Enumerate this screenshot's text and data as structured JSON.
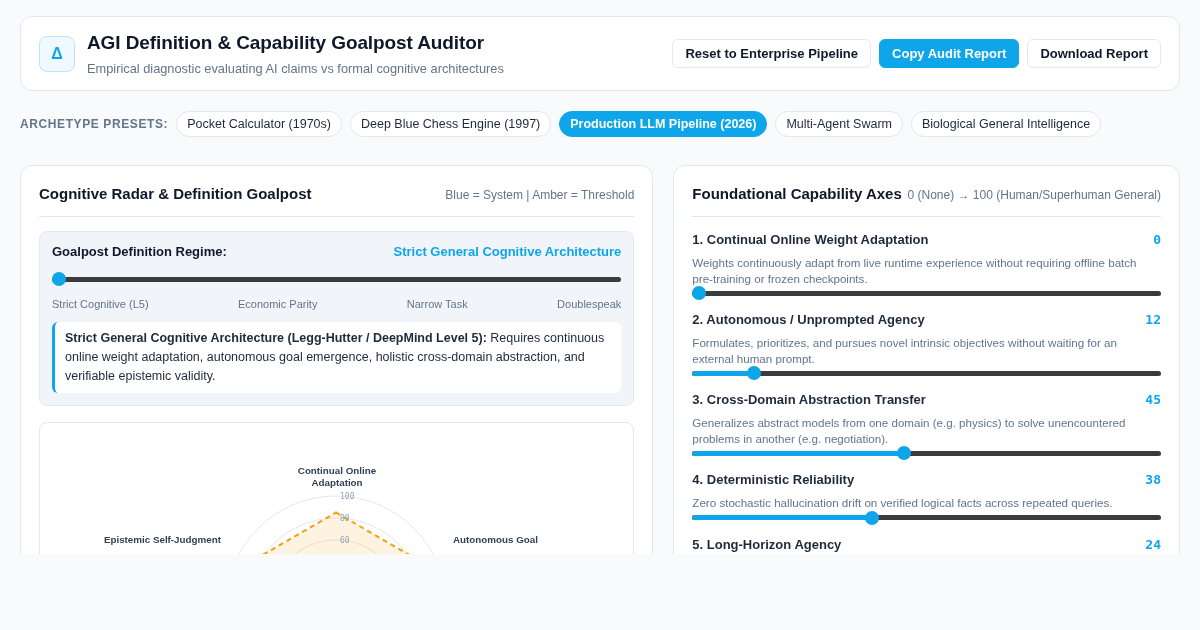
{
  "header": {
    "logo": "Δ",
    "title": "AGI Definition & Capability Goalpost Auditor",
    "subtitle": "Empirical diagnostic evaluating AI claims vs formal cognitive architectures",
    "buttons": [
      {
        "label": "Reset to Enterprise Pipeline",
        "kind": "outline"
      },
      {
        "label": "Copy Audit Report",
        "kind": "primary"
      },
      {
        "label": "Download Report",
        "kind": "outline"
      }
    ]
  },
  "presets": {
    "label": "ARCHETYPE PRESETS:",
    "items": [
      {
        "label": "Pocket Calculator (1970s)",
        "selected": false
      },
      {
        "label": "Deep Blue Chess Engine (1997)",
        "selected": false
      },
      {
        "label": "Production LLM Pipeline (2026)",
        "selected": true
      },
      {
        "label": "Multi-Agent Swarm",
        "selected": false
      },
      {
        "label": "Biological General Intelligence",
        "selected": false
      }
    ]
  },
  "radar_panel": {
    "title": "Cognitive Radar & Definition Goalpost",
    "legend": "Blue = System | Amber = Threshold",
    "regime": {
      "label": "Goalpost Definition Regime:",
      "value": "Strict General Cognitive Architecture",
      "level": 0,
      "ticks": [
        "Strict Cognitive (L5)",
        "Economic Parity",
        "Narrow Task",
        "Doublespeak"
      ],
      "description": "**Strict General Cognitive Architecture (Legg-Hutter / DeepMind Level 5):** Requires continuous online weight adaptation, autonomous goal emergence, holistic cross-domain abstraction, and verifiable epistemic validity."
    },
    "radar": {
      "ring_labels": [
        "100",
        "80",
        "60"
      ],
      "axis_labels": [
        "Continual Online Adaptation",
        "Epistemic Self-Judgment",
        "Autonomous Goal"
      ]
    }
  },
  "capability_panel": {
    "title": "Foundational Capability Axes",
    "scale": "0 (None) → 100 (Human/Superhuman General)",
    "axes": [
      {
        "name": "1. Continual Online Weight Adaptation",
        "score": "0",
        "description": "Weights continuously adapt from live runtime experience without requiring offline batch pre-training or frozen checkpoints.",
        "level": 0
      },
      {
        "name": "2. Autonomous / Unprompted Agency",
        "score": "12",
        "description": "Formulates, prioritizes, and pursues novel intrinsic objectives without waiting for an external human prompt.",
        "level": 0.12
      },
      {
        "name": "3. Cross-Domain Abstraction Transfer",
        "score": "45",
        "description": "Generalizes abstract models from one domain (e.g. physics) to solve unencountered problems in another (e.g. negotiation).",
        "level": 0.45
      },
      {
        "name": "4. Deterministic Reliability",
        "score": "38",
        "description": "Zero stochastic hallucination drift on verified logical facts across repeated queries.",
        "level": 0.38
      },
      {
        "name": "5. Long-Horizon Agency",
        "score": "24"
      }
    ]
  }
}
